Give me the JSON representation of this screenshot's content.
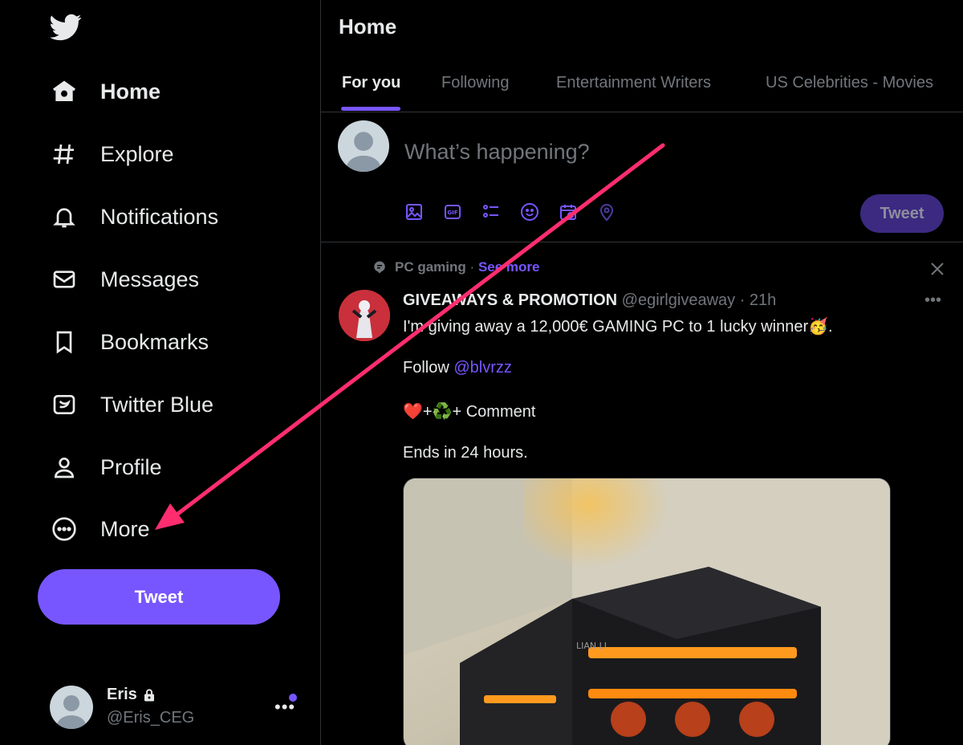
{
  "sidebar": {
    "logo_icon": "twitter-bird-icon",
    "items": [
      {
        "label": "Home",
        "icon": "home-icon",
        "active": true
      },
      {
        "label": "Explore",
        "icon": "hashtag-icon"
      },
      {
        "label": "Notifications",
        "icon": "bell-icon"
      },
      {
        "label": "Messages",
        "icon": "envelope-icon"
      },
      {
        "label": "Bookmarks",
        "icon": "bookmark-icon"
      },
      {
        "label": "Twitter Blue",
        "icon": "twitter-blue-icon"
      },
      {
        "label": "Profile",
        "icon": "person-icon"
      },
      {
        "label": "More",
        "icon": "more-circle-icon"
      }
    ],
    "tweet_button": "Tweet",
    "account": {
      "name": "Eris",
      "handle": "@Eris_CEG",
      "more": "•••"
    }
  },
  "main": {
    "title": "Home",
    "tabs": [
      {
        "label": "For you",
        "active": true
      },
      {
        "label": "Following"
      },
      {
        "label": "Entertainment Writers"
      },
      {
        "label": "US Celebrities - Movies"
      }
    ],
    "compose": {
      "placeholder": "What’s happening?",
      "tweet_button": "Tweet",
      "tools": [
        "image-icon",
        "gif-icon",
        "poll-icon",
        "emoji-icon",
        "schedule-icon",
        "location-icon"
      ]
    },
    "post": {
      "topic": "PC gaming",
      "separator": "·",
      "see_more": "See more",
      "author_name": "GIVEAWAYS & PROMOTION",
      "author_handle": "@egirlgiveaway",
      "time": "· 21h",
      "more": "•••",
      "line1": "I'm giving away a 12,000€ GAMING PC to 1 lucky winner🥳.",
      "follow_prefix": "Follow ",
      "follow_mention": "@blvrzz",
      "line3": "❤️+♻️+ Comment",
      "line4": "Ends in 24 hours.",
      "image_brand": "LIAN LI"
    }
  },
  "colors": {
    "accent": "#7856ff",
    "background": "#000000",
    "text": "#e7e9ea",
    "muted": "#71767b",
    "annotation_arrow": "#ff2d6f"
  }
}
